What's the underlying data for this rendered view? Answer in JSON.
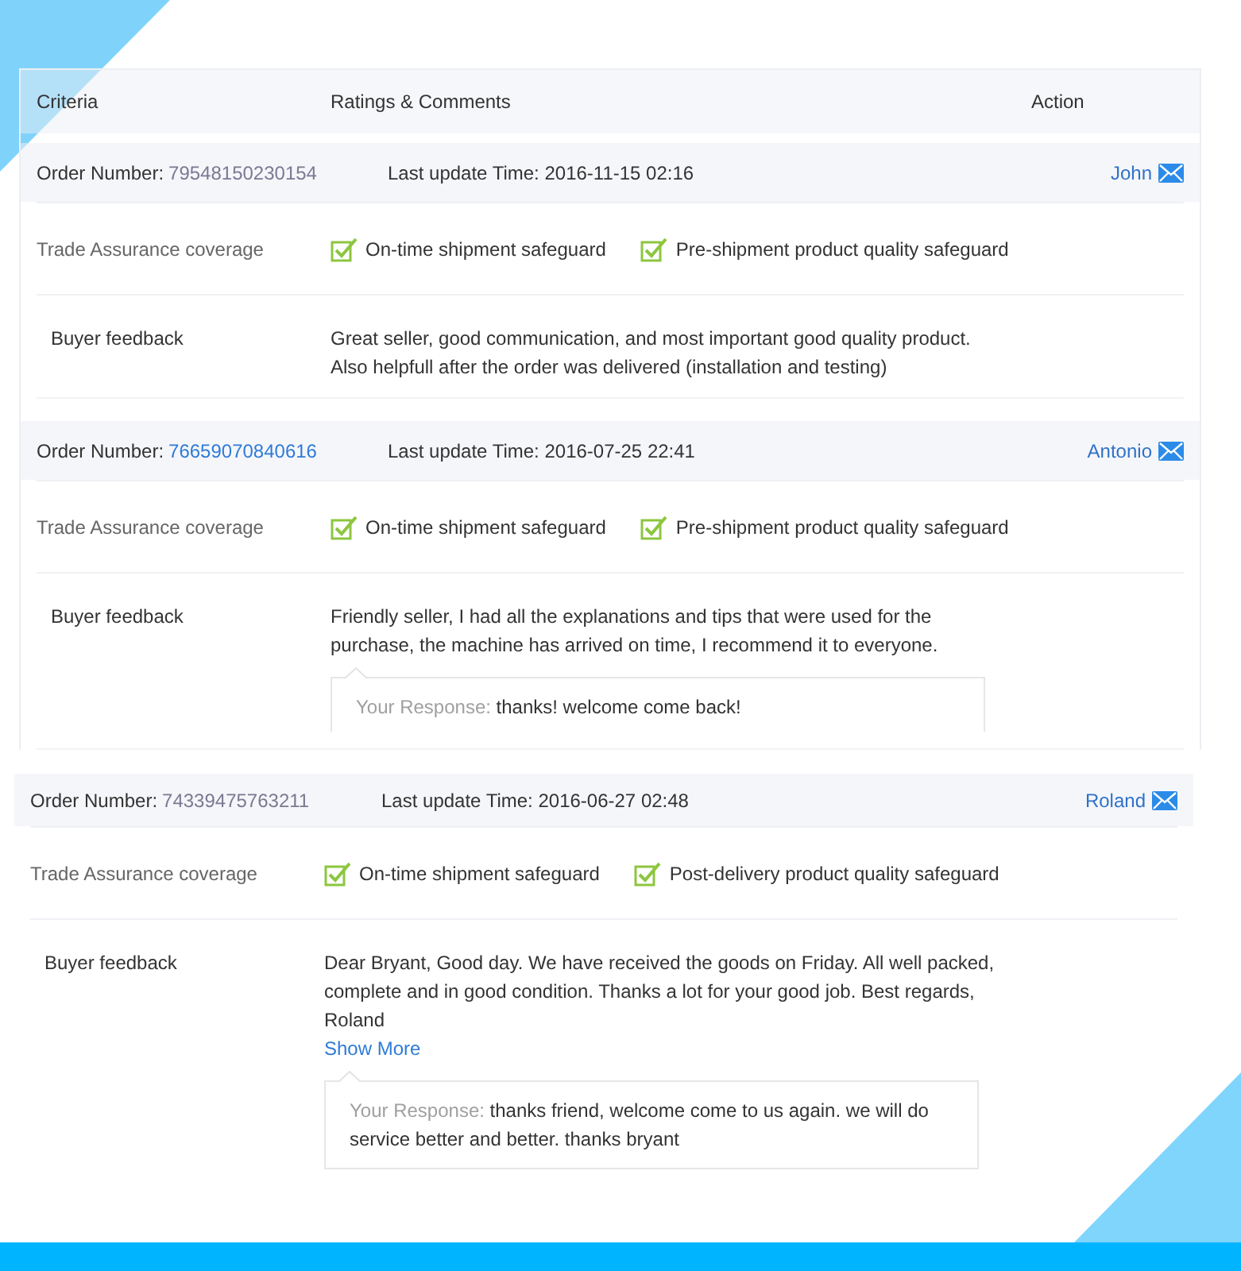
{
  "panels": [
    {
      "columns": [
        "Criteria",
        "Ratings & Comments",
        "Action"
      ],
      "orders": [
        {
          "order_number_label": "Order Number:",
          "order_number": "79548150230154",
          "visited": true,
          "last_update": "Last update Time: 2016-11-15 02:16",
          "buyer": "John",
          "coverage_label": "Trade Assurance coverage",
          "coverage": [
            {
              "label": "On-time shipment safeguard",
              "checked": true
            },
            {
              "label": "Pre-shipment product quality safeguard",
              "checked": true
            }
          ],
          "feedback_label": "Buyer feedback",
          "feedback": "Great seller, good communication, and most important good quality product.\nAlso helpfull after the order was delivered (installation and testing)"
        },
        {
          "order_number_label": "Order Number:",
          "order_number": "76659070840616",
          "visited": false,
          "last_update": "Last update Time: 2016-07-25 22:41",
          "buyer": "Antonio",
          "coverage_label": "Trade Assurance coverage",
          "coverage": [
            {
              "label": "On-time shipment safeguard",
              "checked": true
            },
            {
              "label": "Pre-shipment product quality safeguard",
              "checked": true
            }
          ],
          "feedback_label": "Buyer feedback",
          "feedback": "Friendly seller, I had all the explanations and tips that were used for the\npurchase, the machine has arrived on time, I recommend it to everyone.",
          "response": {
            "label": "Your Response:",
            "text": "thanks! welcome come back!"
          }
        }
      ]
    },
    {
      "orders": [
        {
          "order_number_label": "Order Number:",
          "order_number": "74339475763211",
          "visited": true,
          "last_update": "Last update Time: 2016-06-27 02:48",
          "buyer": "Roland",
          "coverage_label": "Trade Assurance coverage",
          "coverage": [
            {
              "label": "On-time shipment safeguard",
              "checked": true
            },
            {
              "label": "Post-delivery product quality safeguard",
              "checked": true
            }
          ],
          "feedback_label": "Buyer feedback",
          "feedback": "Dear Bryant, Good day. We have received the goods on Friday. All well packed,\ncomplete and in good condition. Thanks a lot for your good job. Best regards,\nRoland",
          "show_more": "Show More",
          "response": {
            "label": "Your Response:",
            "text": "thanks friend, welcome come to us again. we will do\nservice better and better. thanks bryant"
          }
        }
      ]
    }
  ]
}
